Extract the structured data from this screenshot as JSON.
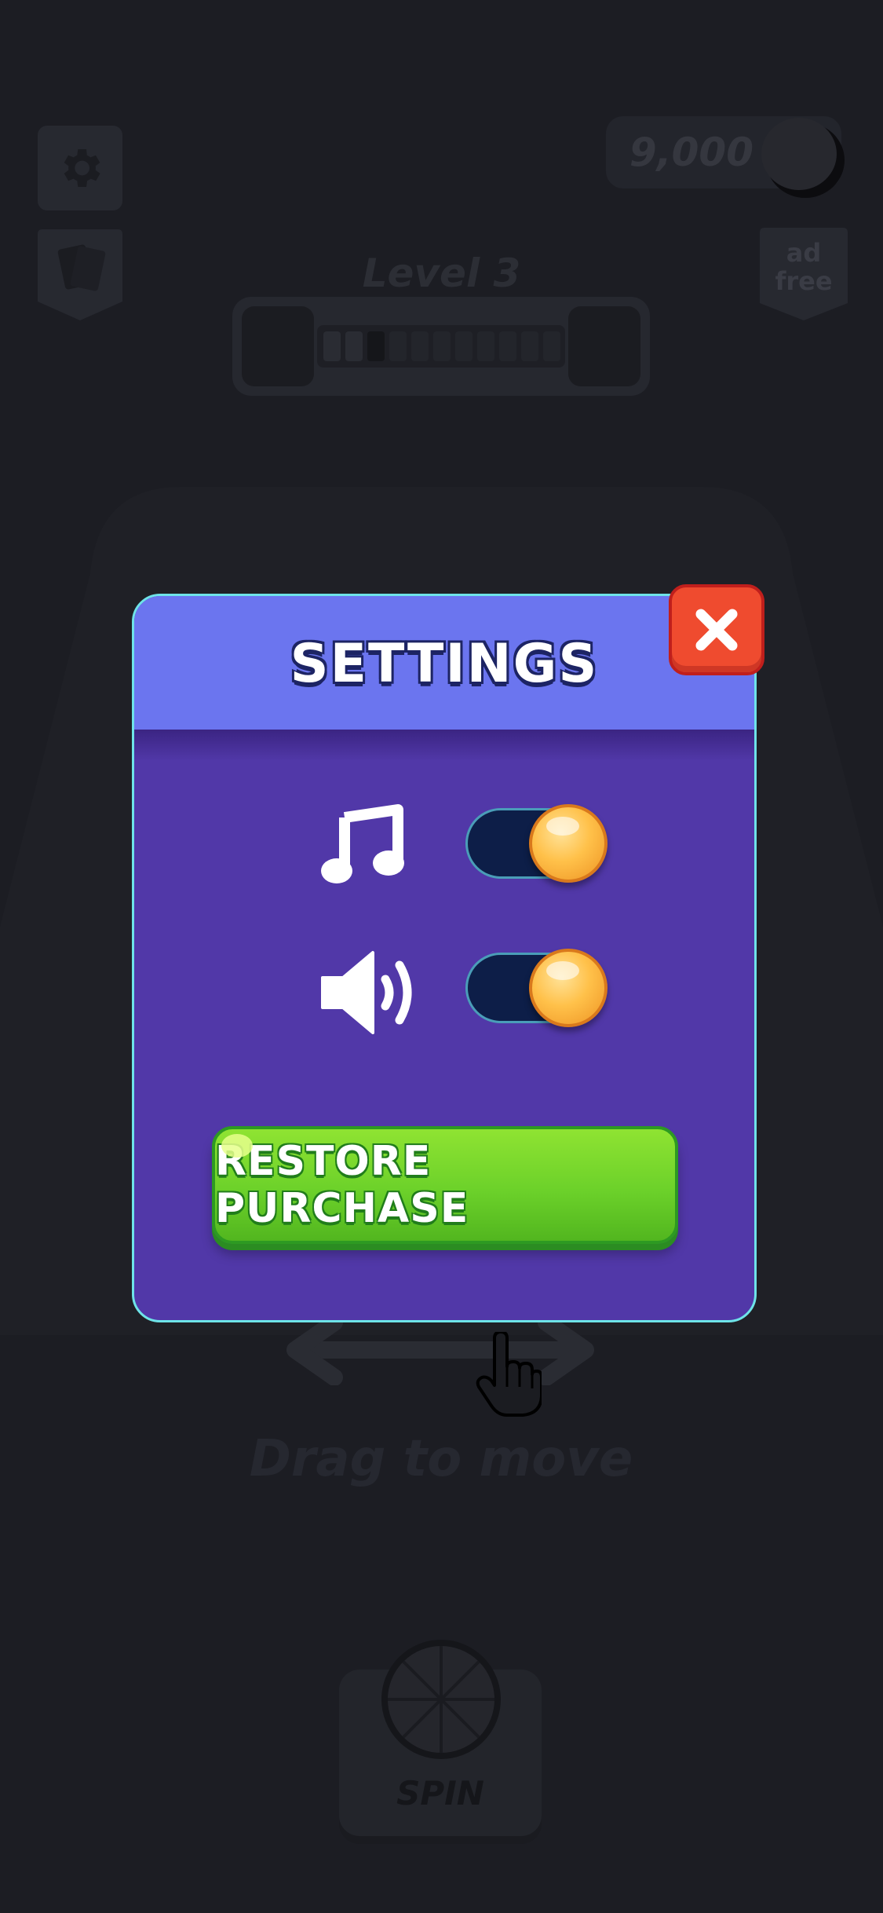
{
  "hud": {
    "coins": "9,000",
    "ad_free_line1": "ad",
    "ad_free_line2": "free",
    "level_label": "Level 3"
  },
  "background": {
    "hint_text": "Drag to move",
    "spin_label": "SPIN"
  },
  "settings_modal": {
    "title": "SETTINGS",
    "music_toggle": {
      "icon": "music-note-icon",
      "on": true
    },
    "sound_toggle": {
      "icon": "speaker-icon",
      "on": true
    },
    "restore_label": "RESTORE PURCHASE",
    "close_icon": "close-icon"
  },
  "colors": {
    "modal_body": "#5138a8",
    "modal_header": "#6b75ef",
    "modal_border": "#6ee3e8",
    "close_red": "#ef4b2f",
    "restore_green": "#6cd12a",
    "toggle_track": "#0d1e48",
    "toggle_knob": "#ffc14a"
  }
}
